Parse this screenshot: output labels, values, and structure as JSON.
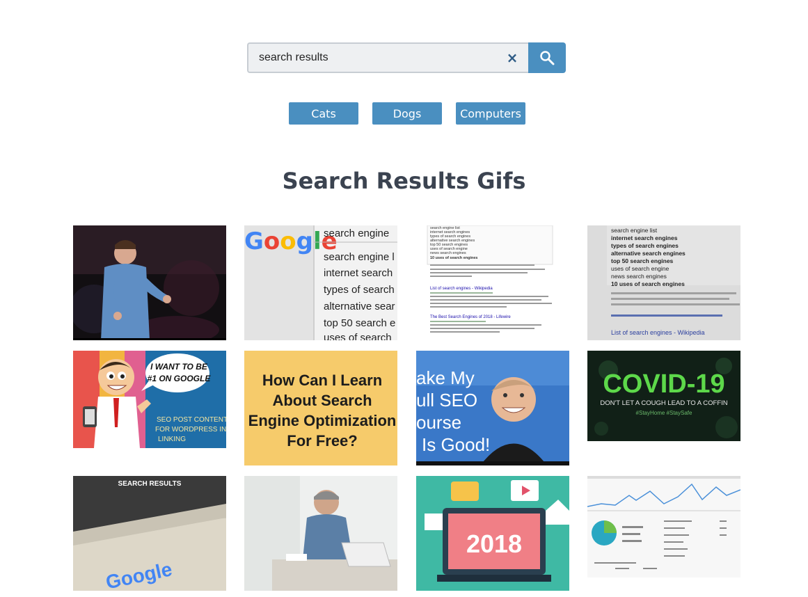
{
  "search": {
    "value": "search results",
    "clear_glyph": "×"
  },
  "tags": [
    "Cats",
    "Dogs",
    "Computers"
  ],
  "heading": "Search Results Gifs",
  "colors": {
    "accent": "#4a8fc0",
    "heading": "#3b4350"
  },
  "gifs": {
    "g1": {},
    "g2": {
      "lines": [
        "search engine",
        "search engine l",
        "internet search",
        "types of search",
        "alternative sear",
        "top 50 search e",
        "uses of search"
      ]
    },
    "g3": {
      "lines": [
        "search engine list",
        "internet search engines",
        "types of search engines",
        "alternative search engines",
        "top 50 search engines",
        "uses of search engine",
        "news search engines",
        "10 uses of search engines",
        "List of search engines - Wikipedia",
        "The Best Search Engines of 2018 - Lifewire"
      ]
    },
    "g4": {
      "lines": [
        "search engine list",
        "internet search engines",
        "types of search engines",
        "alternative search engines",
        "top 50 search engines",
        "uses of search engine",
        "news search engines",
        "10 uses of search engines",
        "List of search engines - Wikipedia"
      ]
    },
    "g5": {
      "bubble": [
        "I WANT TO BE",
        "#1 ON GOOGLE"
      ],
      "caption": [
        "SEO POST CONTENT",
        "FOR WORDPRESS INT",
        "LINKING"
      ]
    },
    "g6": {
      "lines": [
        "How Can I Learn",
        "About Search",
        "Engine Optimization",
        "For Free?"
      ]
    },
    "g7": {
      "lines": [
        "ake My",
        "ull SEO",
        "ourse",
        "Is Good!"
      ]
    },
    "g8": {
      "title": "COVID-19",
      "subtitle": "DON'T LET A COUGH LEAD TO A COFFIN",
      "tags": "#StayHome   #StaySafe"
    },
    "g9": {
      "title": "SEARCH RESULTS",
      "logo": "Google"
    },
    "g10": {},
    "g11": {
      "year": "2018"
    },
    "g12": {}
  }
}
